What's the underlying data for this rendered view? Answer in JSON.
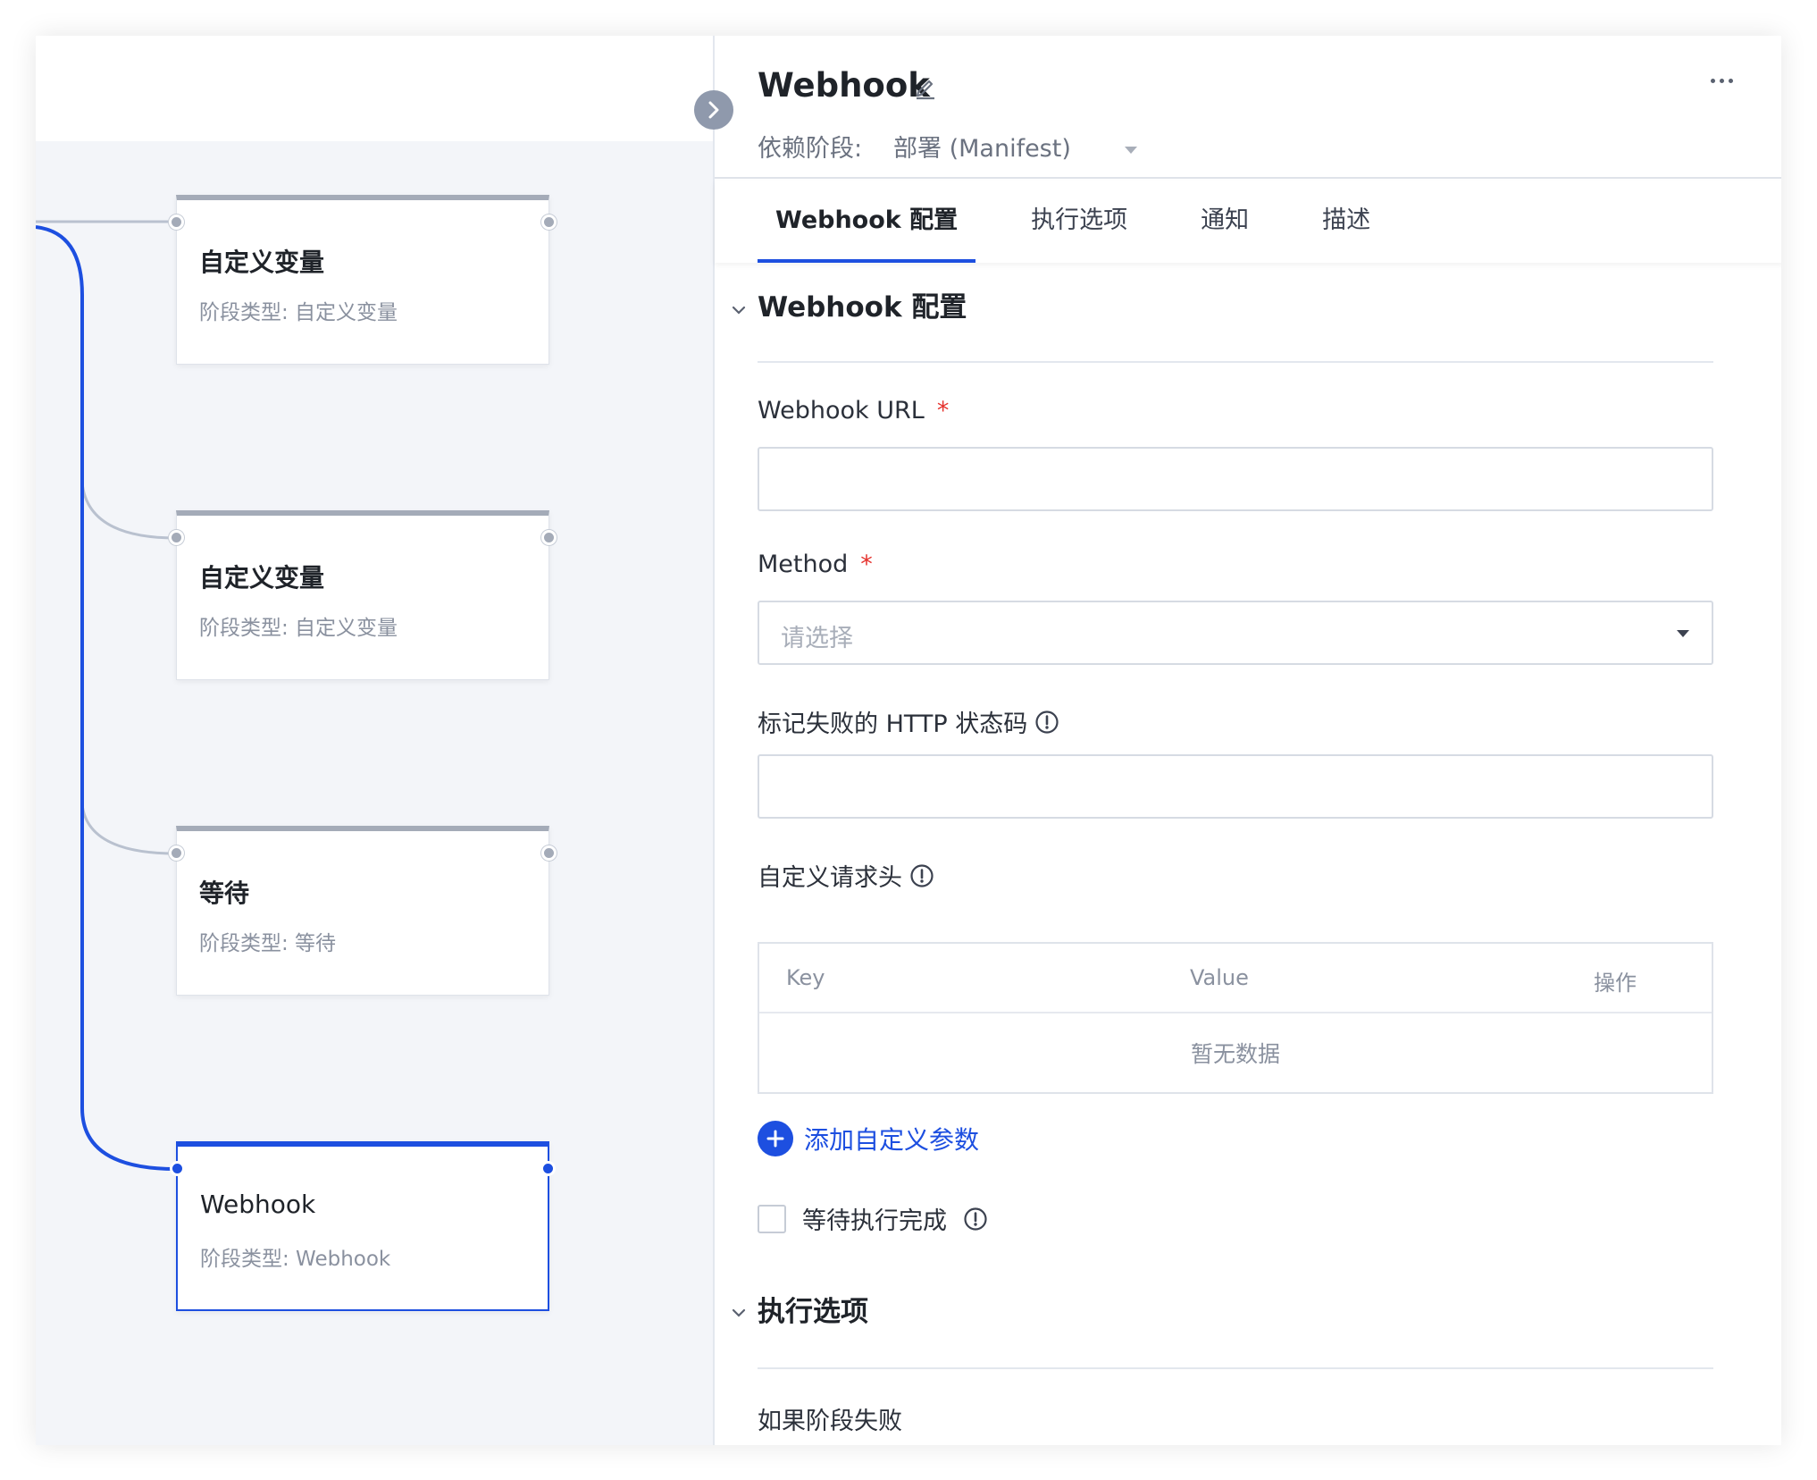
{
  "panel": {
    "title": "Webhook",
    "dependency_label": "依赖阶段:",
    "dependency_value": "部署 (Manifest)"
  },
  "tabs": [
    {
      "label": "Webhook 配置",
      "active": true
    },
    {
      "label": "执行选项",
      "active": false
    },
    {
      "label": "通知",
      "active": false
    },
    {
      "label": "描述",
      "active": false
    }
  ],
  "stages": [
    {
      "name": "自定义变量",
      "type": "阶段类型:  自定义变量",
      "active": false
    },
    {
      "name": "自定义变量",
      "type": "阶段类型:  自定义变量",
      "active": false
    },
    {
      "name": "等待",
      "type": "阶段类型:  等待",
      "active": false
    },
    {
      "name": "Webhook",
      "type": "阶段类型:  Webhook",
      "active": true
    }
  ],
  "webhook_section": {
    "title": "Webhook 配置",
    "url_label": "Webhook URL",
    "url_value": "",
    "method_label": "Method",
    "method_placeholder": "请选择",
    "fail_codes_label": "标记失败的 HTTP 状态码",
    "fail_codes_value": "",
    "headers_label": "自定义请求头",
    "headers_table": {
      "columns": [
        "Key",
        "Value",
        "操作"
      ],
      "rows": [],
      "empty_text": "暂无数据"
    },
    "add_param_label": "添加自定义参数",
    "wait_label": "等待执行完成",
    "wait_checked": false,
    "required_mark": "*"
  },
  "exec_section": {
    "title": "执行选项",
    "if_fail_label": "如果阶段失败"
  },
  "colors": {
    "accent": "#1d4fe0",
    "required": "#e5322d",
    "canvas_bg": "#f3f5f9",
    "node_bar": "#a4abb8"
  },
  "icons": {
    "edit": "pencil-icon",
    "more": "more-horizontal-icon",
    "collapse": "chevron-right-icon",
    "section": "chevron-down-icon",
    "info": "info-circle-icon",
    "add": "plus-circle-icon"
  }
}
